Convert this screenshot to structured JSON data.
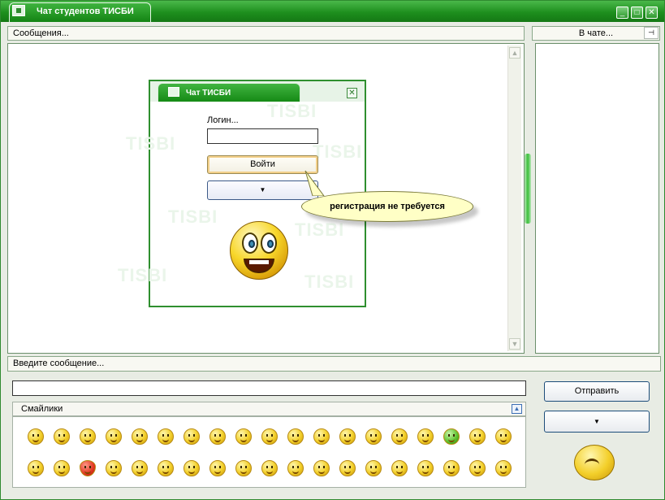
{
  "window": {
    "title": "Чат студентов ТИСБИ",
    "controls": [
      "minimize",
      "maximize",
      "close"
    ]
  },
  "messages_panel": {
    "label": "Сообщения..."
  },
  "online_panel": {
    "label": "В чате..."
  },
  "login_dialog": {
    "title": "Чат ТИСБИ",
    "login_label": "Логин...",
    "login_value": "",
    "enter_button": "Войти",
    "watermark": "TISBI"
  },
  "tooltip": {
    "text": "регистрация не требуется"
  },
  "message_input": {
    "label": "Введите сообщение...",
    "value": ""
  },
  "send_button": {
    "label": "Отправить"
  },
  "smileys": {
    "label": "Смайлики",
    "row1_count": 19,
    "row2_count": 19
  },
  "colors": {
    "accent": "#1e8f1e",
    "background": "#e8ece4",
    "tooltip": "#ffffc6"
  },
  "icons": {
    "app": "chat-app-icon",
    "pin": "pin-icon",
    "scroll_up": "scroll-up-arrow-icon",
    "scroll_down": "scroll-down-arrow-icon",
    "dropdown": "chevron-down-icon",
    "collapse": "collapse-up-icon"
  }
}
